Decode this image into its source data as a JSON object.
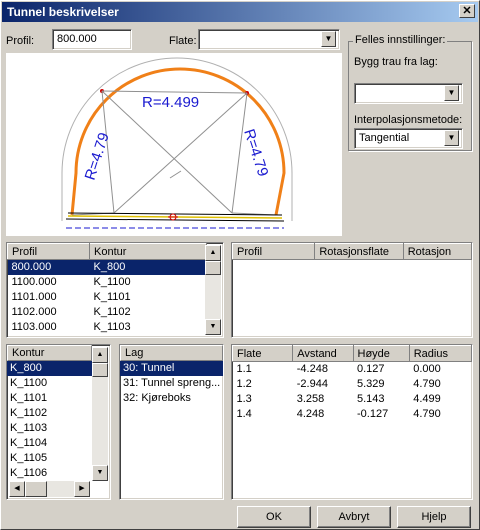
{
  "window": {
    "title": "Tunnel beskrivelser",
    "close_glyph": "✕"
  },
  "profile_field": {
    "label": "Profil:",
    "value": "800.000"
  },
  "flate_field": {
    "label": "Flate:",
    "value": ""
  },
  "common_settings": {
    "title": "Felles innstillinger:",
    "bygg_label": "Bygg trau fra lag:",
    "bygg_value": "",
    "interp_label": "Interpolasjonsmetode:",
    "interp_value": "Tangential"
  },
  "preview": {
    "radius_top": "R=4.499",
    "radius_left": "R=4.79",
    "radius_right": "R=4.79",
    "arc_color": "#f08018",
    "text_color": "#1a1ad0"
  },
  "profile_table": {
    "headers": [
      "Profil",
      "Kontur"
    ],
    "rows": [
      [
        "800.000",
        "K_800"
      ],
      [
        "1100.000",
        "K_1100"
      ],
      [
        "1101.000",
        "K_1101"
      ],
      [
        "1102.000",
        "K_1102"
      ],
      [
        "1103.000",
        "K_1103"
      ]
    ],
    "selected": 0
  },
  "rotation_table": {
    "headers": [
      "Profil",
      "Rotasjonsflate",
      "Rotasjon"
    ],
    "rows": []
  },
  "kontur_list": {
    "header": "Kontur",
    "items": [
      "K_800",
      "K_1100",
      "K_1101",
      "K_1102",
      "K_1103",
      "K_1104",
      "K_1105",
      "K_1106"
    ],
    "selected": 0
  },
  "lag_list": {
    "header": "Lag",
    "items": [
      "30: Tunnel",
      "31: Tunnel spreng...",
      "32: Kjøreboks"
    ],
    "selected": 0
  },
  "flate_table": {
    "headers": [
      "Flate",
      "Avstand",
      "Høyde",
      "Radius"
    ],
    "rows": [
      [
        "1.1",
        "-4.248",
        "0.127",
        "0.000"
      ],
      [
        "1.2",
        "-2.944",
        "5.329",
        "4.790"
      ],
      [
        "1.3",
        "3.258",
        "5.143",
        "4.499"
      ],
      [
        "1.4",
        "4.248",
        "-0.127",
        "4.790"
      ]
    ]
  },
  "buttons": {
    "ok": "OK",
    "cancel": "Avbryt",
    "help": "Hjelp"
  }
}
